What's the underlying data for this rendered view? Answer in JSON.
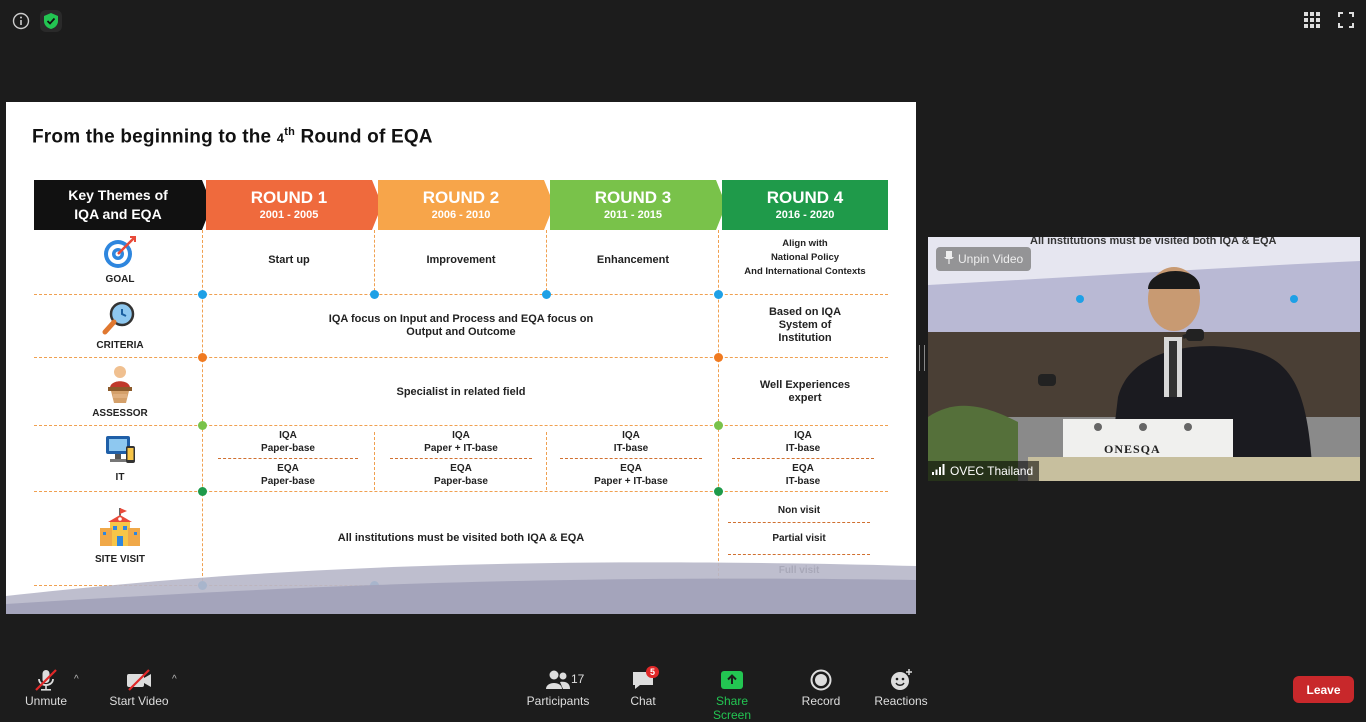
{
  "slide": {
    "title_pre": "From the beginning to the ",
    "title_sub": "4",
    "title_sup": "th",
    "title_post": " Round of EQA",
    "key_header_line1": "Key Themes of",
    "key_header_line2": "IQA and EQA",
    "rounds": [
      {
        "label": "ROUND 1",
        "years": "2001 - 2005",
        "color": "#ef6a3d"
      },
      {
        "label": "ROUND 2",
        "years": "2006 - 2010",
        "color": "#f7a54a"
      },
      {
        "label": "ROUND 3",
        "years": "2011 - 2015",
        "color": "#79c24a"
      },
      {
        "label": "ROUND 4",
        "years": "2016 - 2020",
        "color": "#1f9a4a"
      }
    ],
    "rows": {
      "goal": {
        "label": "GOAL",
        "r1": "Start up",
        "r2": "Improvement",
        "r3": "Enhancement",
        "r4_line1": "Align with",
        "r4_line2": "National Policy",
        "r4_line3": "And International Contexts"
      },
      "criteria": {
        "label": "CRITERIA",
        "r13_line1": "IQA focus on Input and Process and EQA focus on",
        "r13_line2": "Output and Outcome",
        "r4_line1": "Based on IQA",
        "r4_line2": "System of",
        "r4_line3": "Institution"
      },
      "assessor": {
        "label": "ASSESSOR",
        "r13": "Specialist in related field",
        "r4_line1": "Well Experiences",
        "r4_line2": "expert"
      },
      "it": {
        "label": "IT",
        "r1_top": [
          "IQA",
          "Paper-base"
        ],
        "r1_bot": [
          "EQA",
          "Paper-base"
        ],
        "r2_top": [
          "IQA",
          "Paper + IT-base"
        ],
        "r2_bot": [
          "EQA",
          "Paper-base"
        ],
        "r3_top": [
          "IQA",
          "IT-base"
        ],
        "r3_bot": [
          "EQA",
          "Paper + IT-base"
        ],
        "r4_top": [
          "IQA",
          "IT-base"
        ],
        "r4_bot": [
          "EQA",
          "IT-base"
        ]
      },
      "site_visit": {
        "label": "SITE VISIT",
        "r13": "All  institutions must be visited both IQA & EQA",
        "r4_opts": [
          "Non visit",
          "Partial visit",
          "Full visit"
        ]
      }
    }
  },
  "video": {
    "unpin_label": "Unpin Video",
    "participant_name": "OVEC Thailand",
    "banner_text": "All  institutions must be visited both IQA & EQA",
    "nameplate": "ONESQA"
  },
  "toolbar": {
    "unmute": "Unmute",
    "start_video": "Start Video",
    "participants": "Participants",
    "participants_count": "17",
    "chat": "Chat",
    "chat_badge": "5",
    "share_screen": "Share Screen",
    "record": "Record",
    "reactions": "Reactions",
    "leave": "Leave"
  },
  "colors": {
    "accent_green": "#23c552",
    "leave_red": "#c8282b",
    "dash_orange": "#f0a050"
  }
}
